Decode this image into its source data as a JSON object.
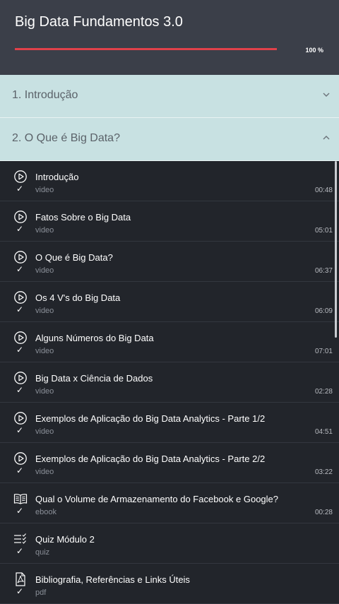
{
  "course": {
    "title": "Big Data Fundamentos 3.0",
    "progress_label": "100 %",
    "progress_fraction": 1.0
  },
  "sections": [
    {
      "label": "1. Introdução",
      "state": "collapsed"
    },
    {
      "label": "2. O Que é Big Data?",
      "state": "expanded"
    }
  ],
  "lessons": [
    {
      "title": "Introdução",
      "type": "video",
      "duration": "00:48",
      "icon": "play-circle-icon"
    },
    {
      "title": "Fatos Sobre o Big Data",
      "type": "video",
      "duration": "05:01",
      "icon": "play-circle-icon"
    },
    {
      "title": "O Que é Big Data?",
      "type": "video",
      "duration": "06:37",
      "icon": "play-circle-icon"
    },
    {
      "title": "Os 4 V's do Big Data",
      "type": "video",
      "duration": "06:09",
      "icon": "play-circle-icon"
    },
    {
      "title": "Alguns Números do Big Data",
      "type": "video",
      "duration": "07:01",
      "icon": "play-circle-icon"
    },
    {
      "title": "Big Data x Ciência de Dados",
      "type": "video",
      "duration": "02:28",
      "icon": "play-circle-icon"
    },
    {
      "title": "Exemplos de Aplicação do Big Data Analytics - Parte 1/2",
      "type": "video",
      "duration": "04:51",
      "icon": "play-circle-icon"
    },
    {
      "title": "Exemplos de Aplicação do Big Data Analytics - Parte 2/2",
      "type": "video",
      "duration": "03:22",
      "icon": "play-circle-icon"
    },
    {
      "title": "Qual o Volume de Armazenamento do Facebook e Google?",
      "type": "ebook",
      "duration": "00:28",
      "icon": "book-icon"
    },
    {
      "title": "Quiz Módulo 2",
      "type": "quiz",
      "duration": "",
      "icon": "quiz-list-icon"
    },
    {
      "title": "Bibliografia, Referências e Links Úteis",
      "type": "pdf",
      "duration": "",
      "icon": "pdf-icon"
    }
  ],
  "check_glyph": "✓",
  "colors": {
    "progress": "#e0414a",
    "header": "#3b3f49",
    "section": "#c8e1e2",
    "list_bg": "#22252b"
  }
}
